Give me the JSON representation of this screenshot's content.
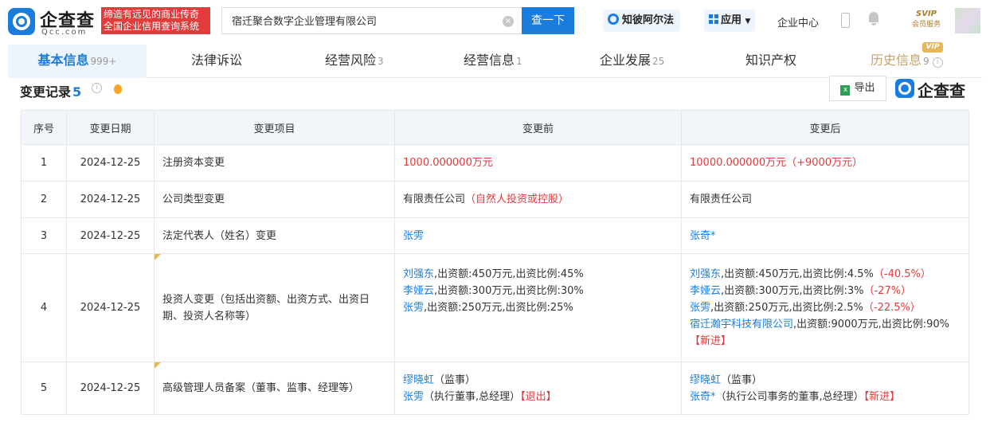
{
  "header": {
    "logo_cn": "企查查",
    "logo_en": "Qcc.com",
    "slogan_line1": "缔造有远见的商业传奇",
    "slogan_line2": "全国企业信用查询系统",
    "search_value": "宿迁聚合数字企业管理有限公司",
    "search_button": "查一下",
    "zhibo_label": "知彼阿尔法",
    "app_label": "应用",
    "enterprise_center": "企业中心",
    "svip_top": "SVIP",
    "svip_bottom": "会员服务"
  },
  "tabs": [
    {
      "label": "基本信息",
      "count": "999+"
    },
    {
      "label": "法律诉讼",
      "count": ""
    },
    {
      "label": "经营风险",
      "count": "3"
    },
    {
      "label": "经营信息",
      "count": "1"
    },
    {
      "label": "企业发展",
      "count": "25"
    },
    {
      "label": "知识产权",
      "count": ""
    },
    {
      "label": "历史信息",
      "count": "9"
    }
  ],
  "vip_badge": "VIP",
  "section": {
    "title": "变更记录",
    "count": "5",
    "export_label": "导出",
    "watermark": "企查查"
  },
  "table": {
    "headers": [
      "序号",
      "变更日期",
      "变更项目",
      "变更前",
      "变更后"
    ],
    "rows": [
      {
        "no": "1",
        "date": "2024-12-25",
        "item": "注册资本变更",
        "before": "1000.000000万元",
        "after": "10000.000000万元（+9000万元）"
      },
      {
        "no": "2",
        "date": "2024-12-25",
        "item": "公司类型变更",
        "before_main": "有限责任公司",
        "before_note": "（自然人投资或控股）",
        "after": "有限责任公司"
      },
      {
        "no": "3",
        "date": "2024-12-25",
        "item": "法定代表人（姓名）变更",
        "before": "张雱",
        "after": "张奇*"
      },
      {
        "no": "4",
        "date": "2024-12-25",
        "item": "投资人变更（包括出资额、出资方式、出资日期、投资人名称等）",
        "before": [
          {
            "name": "刘强东",
            "detail": ",出资额:450万元,出资比例:45%"
          },
          {
            "name": "李娅云",
            "detail": ",出资额:300万元,出资比例:30%"
          },
          {
            "name": "张雱",
            "detail": ",出资额:250万元,出资比例:25%"
          }
        ],
        "after": [
          {
            "name": "刘强东",
            "detail": ",出资额:450万元,出资比例:4.5%",
            "delta": "（-40.5%）"
          },
          {
            "name": "李娅云",
            "detail": ",出资额:300万元,出资比例:3%",
            "delta": "（-27%）"
          },
          {
            "name": "张雱",
            "detail": ",出资额:250万元,出资比例:2.5%",
            "delta": "（-22.5%）"
          },
          {
            "name": "宿迁瀚宇科技有限公司",
            "detail": ",出资额:9000万元,出资比例:90%",
            "delta": "【新进】"
          }
        ]
      },
      {
        "no": "5",
        "date": "2024-12-25",
        "item": "高级管理人员备案（董事、监事、经理等）",
        "before": [
          {
            "name": "缪晓虹",
            "detail": "（监事）",
            "tag": ""
          },
          {
            "name": "张雱",
            "detail": "（执行董事,总经理）",
            "tag": "【退出】"
          }
        ],
        "after": [
          {
            "name": "缪晓虹",
            "detail": "（监事）",
            "tag": ""
          },
          {
            "name": "张奇*",
            "detail": "（执行公司事务的董事,总经理）",
            "tag": "【新进】"
          }
        ]
      }
    ]
  },
  "colors": {
    "brand_blue": "#1a7dde",
    "red": "#e4393c",
    "vip_gold": "#e8b65a"
  }
}
